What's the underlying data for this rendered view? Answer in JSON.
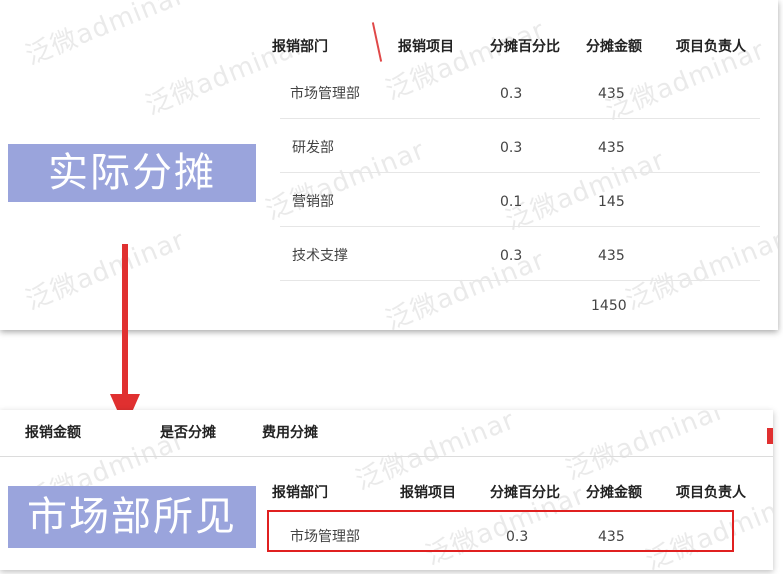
{
  "actual": {
    "label": "实际分摊",
    "columns": [
      "报销部门",
      "报销项目",
      "分摊百分比",
      "分摊金额",
      "项目负责人"
    ],
    "rows": [
      {
        "dept": "市场管理部",
        "pct": "0.3",
        "amount": "435"
      },
      {
        "dept": "研发部",
        "pct": "0.3",
        "amount": "435"
      },
      {
        "dept": "营销部",
        "pct": "0.1",
        "amount": "145"
      },
      {
        "dept": "技术支撑",
        "pct": "0.3",
        "amount": "435"
      }
    ],
    "total": "1450"
  },
  "visible": {
    "label": "市场部所见",
    "tabs": [
      "报销金额",
      "是否分摊",
      "费用分摊"
    ],
    "columns": [
      "报销部门",
      "报销项目",
      "分摊百分比",
      "分摊金额",
      "项目负责人"
    ],
    "row": {
      "dept": "市场管理部",
      "pct": "0.3",
      "amount": "435"
    }
  },
  "watermark_text": "泛微adminar",
  "colors": {
    "label_bg": "#9aa4dc",
    "arrow": "#e03030",
    "highlight": "#e02020"
  }
}
